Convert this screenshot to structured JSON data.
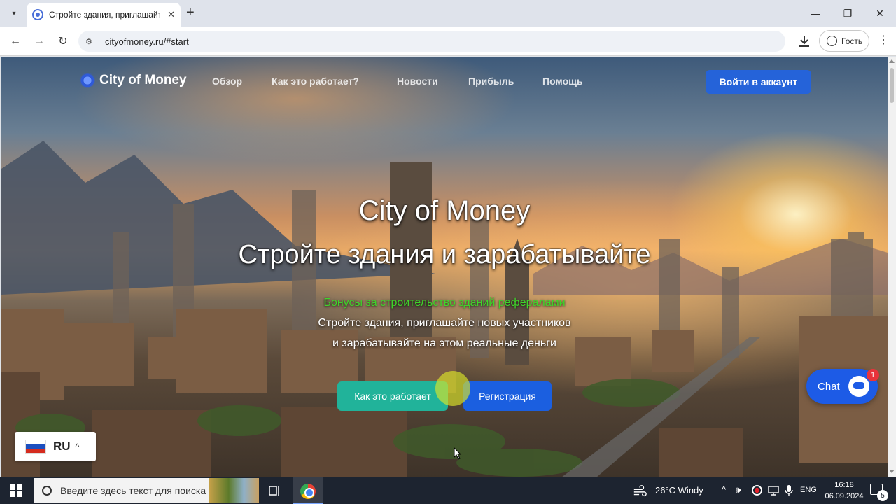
{
  "browser": {
    "tab_title": "Стройте здания, приглашайте",
    "url": "cityofmoney.ru/#start",
    "guest_label": "Гость"
  },
  "site": {
    "logo_text": "City of Money",
    "nav": [
      {
        "label": "Обзор"
      },
      {
        "label": "Как это работает?"
      },
      {
        "label": "Новости"
      },
      {
        "label": "Прибыль"
      },
      {
        "label": "Помощь"
      }
    ],
    "login_button": "Войти в аккаунт"
  },
  "hero": {
    "title": "City of Money",
    "subtitle": "Стройте здания и зарабатывайте",
    "green_line": "Бонусы за строительство зданий рефералами",
    "line2": "Стройте здания, приглашайте новых участников",
    "line3": "и зарабатывайте на этом реальные деньги",
    "btn_how": "Как это работает",
    "btn_register": "Регистрация"
  },
  "widgets": {
    "language": "RU",
    "chat_label": "Chat",
    "chat_badge": "1"
  },
  "taskbar": {
    "search_placeholder": "Введите здесь текст для поиска",
    "weather": "26°C  Windy",
    "lang": "ENG",
    "time": "16:18",
    "date": "06.09.2024",
    "notif_count": "5"
  },
  "colors": {
    "login_btn": "#2563d9",
    "how_btn": "#21b39a",
    "register_btn": "#1b5fe0",
    "green_text": "#3fd42a",
    "chat": "#1d5be6"
  }
}
